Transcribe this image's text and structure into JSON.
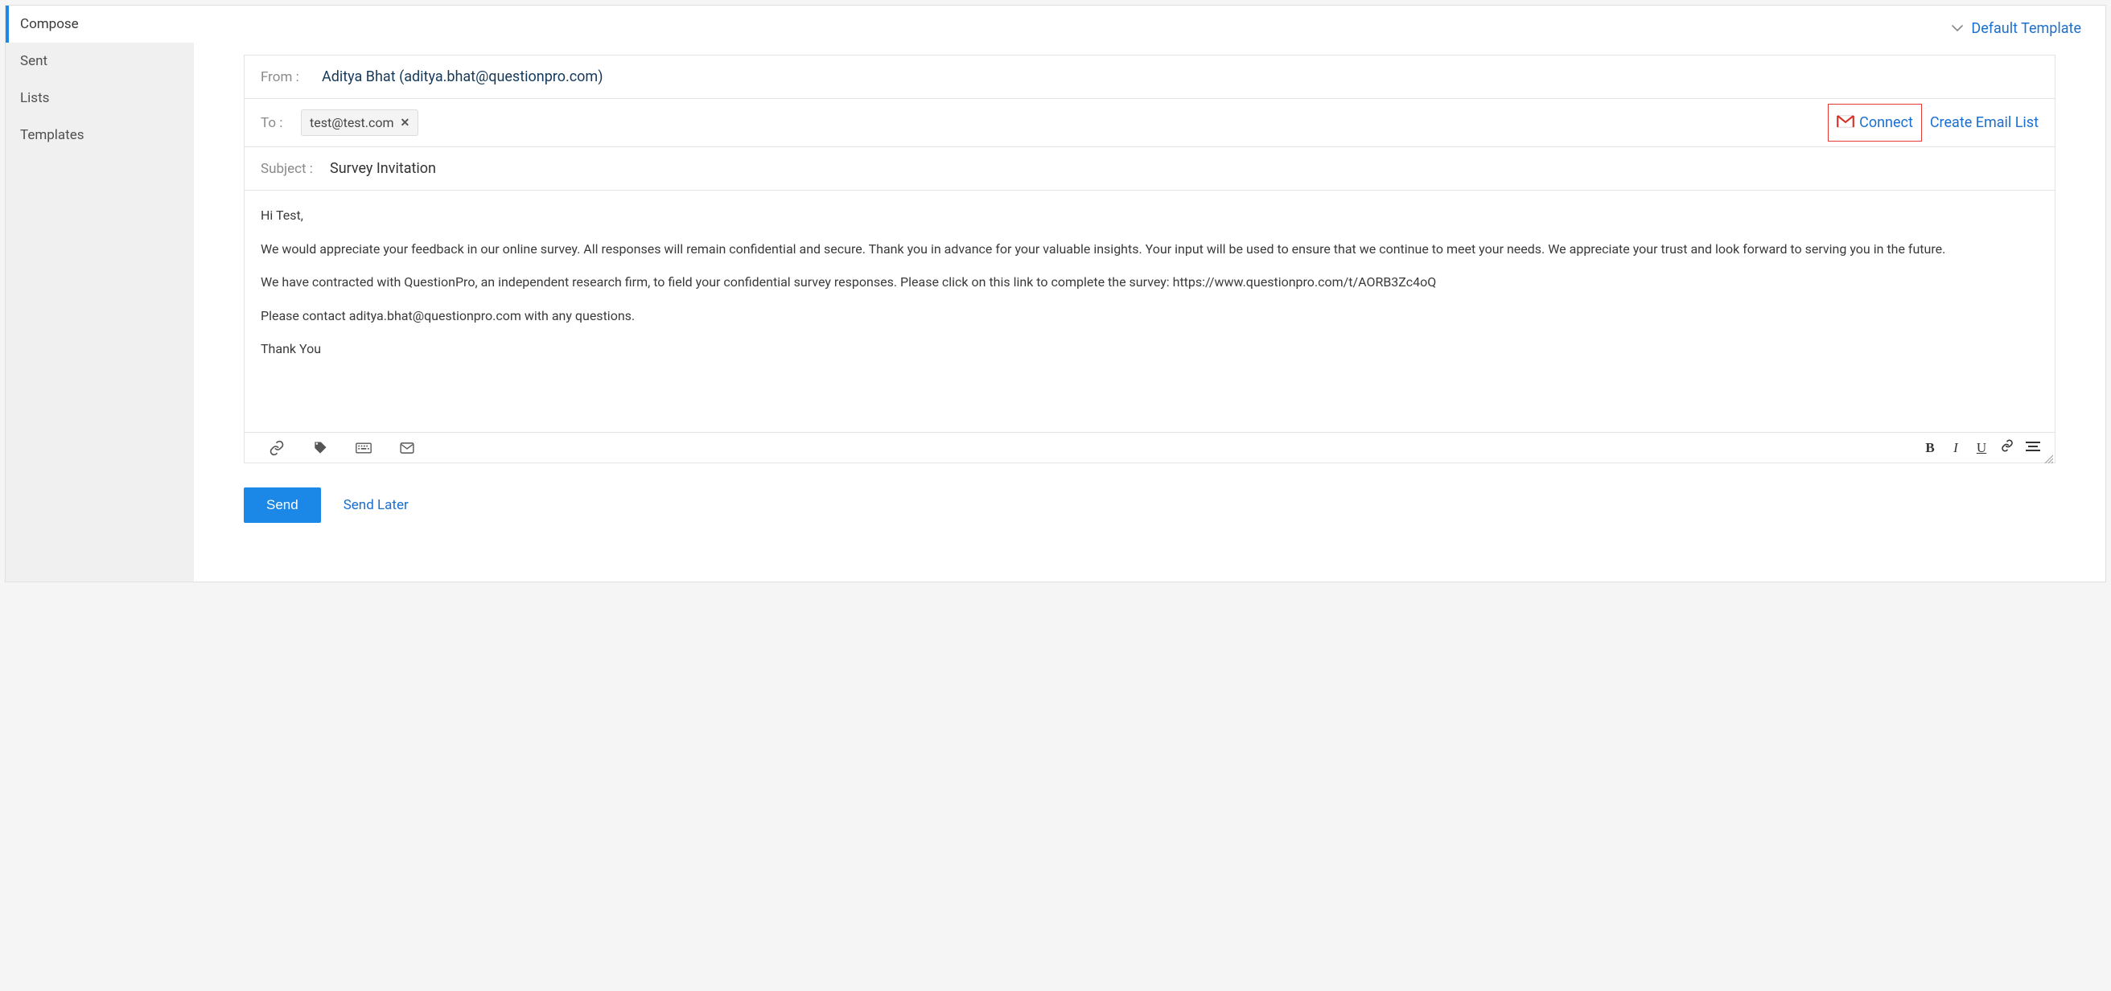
{
  "sidebar": {
    "items": [
      {
        "label": "Compose"
      },
      {
        "label": "Sent"
      },
      {
        "label": "Lists"
      },
      {
        "label": "Templates"
      }
    ]
  },
  "topbar": {
    "default_template": "Default Template"
  },
  "compose": {
    "from_label": "From :",
    "from_value": "Aditya Bhat (aditya.bhat@questionpro.com)",
    "to_label": "To :",
    "to_chip": "test@test.com",
    "connect_label": "Connect",
    "create_list_label": "Create Email List",
    "subject_label": "Subject :",
    "subject_value": "Survey Invitation",
    "body": {
      "p1": "Hi Test,",
      "p2": "We would appreciate your feedback in our online survey.  All responses will remain confidential and secure. Thank you in advance for your valuable insights. Your input will be used to ensure that we continue to meet your needs. We appreciate your trust and look forward to serving you in the future.",
      "p3": "We have contracted with QuestionPro, an independent research firm, to field your confidential survey responses.  Please click on this link to complete the survey: https://www.questionpro.com/t/AORB3Zc4oQ",
      "p4": "Please contact aditya.bhat@questionpro.com with any questions.",
      "p5": "Thank You"
    }
  },
  "format": {
    "bold": "B",
    "italic": "I",
    "underline": "U"
  },
  "actions": {
    "send": "Send",
    "send_later": "Send Later"
  }
}
